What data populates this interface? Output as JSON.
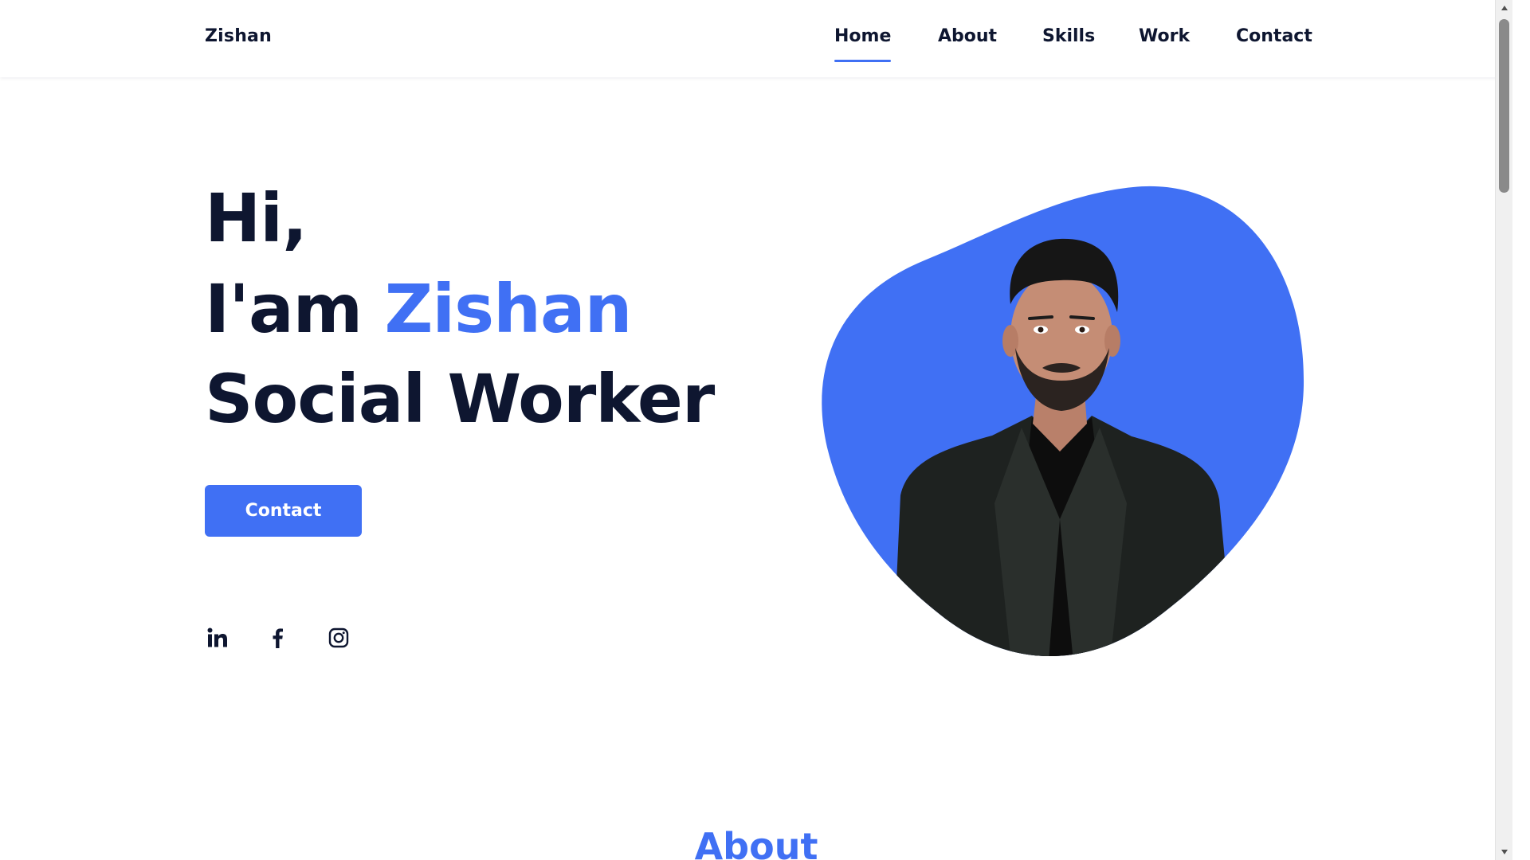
{
  "header": {
    "brand": "Zishan",
    "nav": [
      {
        "label": "Home",
        "active": true
      },
      {
        "label": "About",
        "active": false
      },
      {
        "label": "Skills",
        "active": false
      },
      {
        "label": "Work",
        "active": false
      },
      {
        "label": "Contact",
        "active": false
      }
    ]
  },
  "hero": {
    "line1": "Hi,",
    "line2_prefix": "I'am ",
    "line2_name": "Zishan",
    "line3": "Social Worker",
    "contact_button": "Contact",
    "socials": [
      {
        "icon": "linkedin-icon"
      },
      {
        "icon": "facebook-icon"
      },
      {
        "icon": "instagram-icon"
      }
    ],
    "photo": {
      "icon": "profile-photo"
    }
  },
  "about": {
    "title": "About"
  },
  "colors": {
    "accent": "#4070f4",
    "text": "#0e1630",
    "background": "#ffffff"
  }
}
